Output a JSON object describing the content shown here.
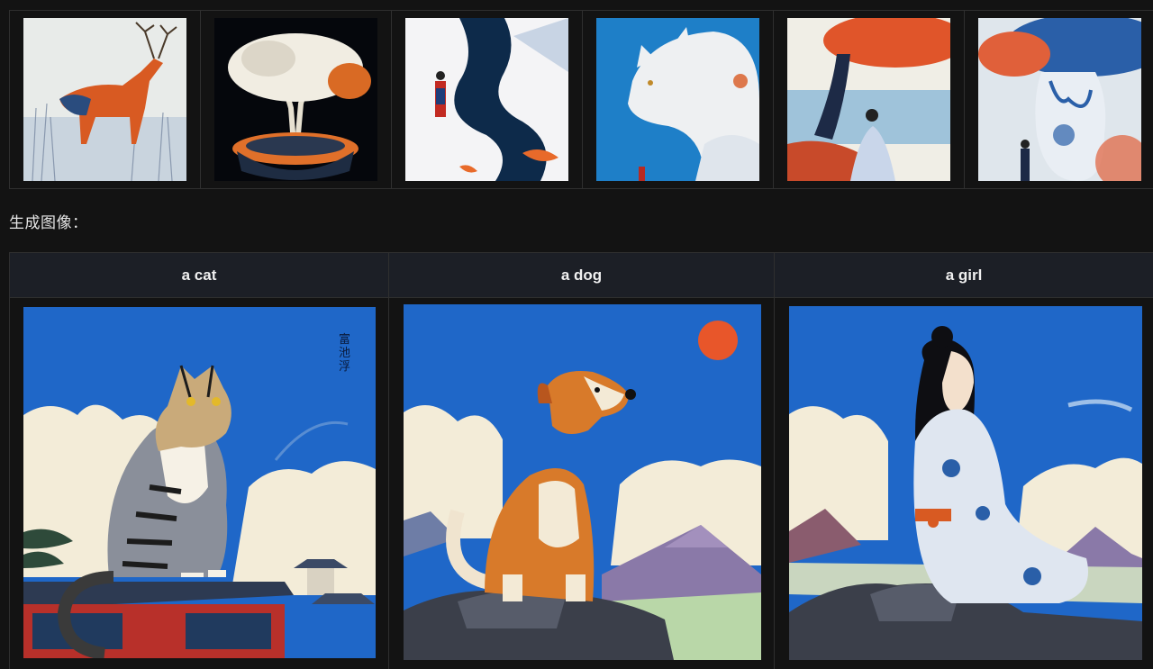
{
  "reference_images": [
    {
      "subject": "deer in reeds"
    },
    {
      "subject": "white bonsai tree"
    },
    {
      "subject": "snowy river with figure and koi"
    },
    {
      "subject": "giant white cat"
    },
    {
      "subject": "woman under tree"
    },
    {
      "subject": "porcelain vase with tree"
    }
  ],
  "section_label": "生成图像：",
  "generated": {
    "columns": [
      {
        "prompt": "a cat"
      },
      {
        "prompt": "a dog"
      },
      {
        "prompt": "a girl"
      }
    ],
    "seal_text": "富\n池\n浮"
  },
  "colors": {
    "sky": "#1f67c8",
    "cloud": "#f3ecd8",
    "orange": "#e86a2a",
    "mountain": "#8a79a8"
  }
}
